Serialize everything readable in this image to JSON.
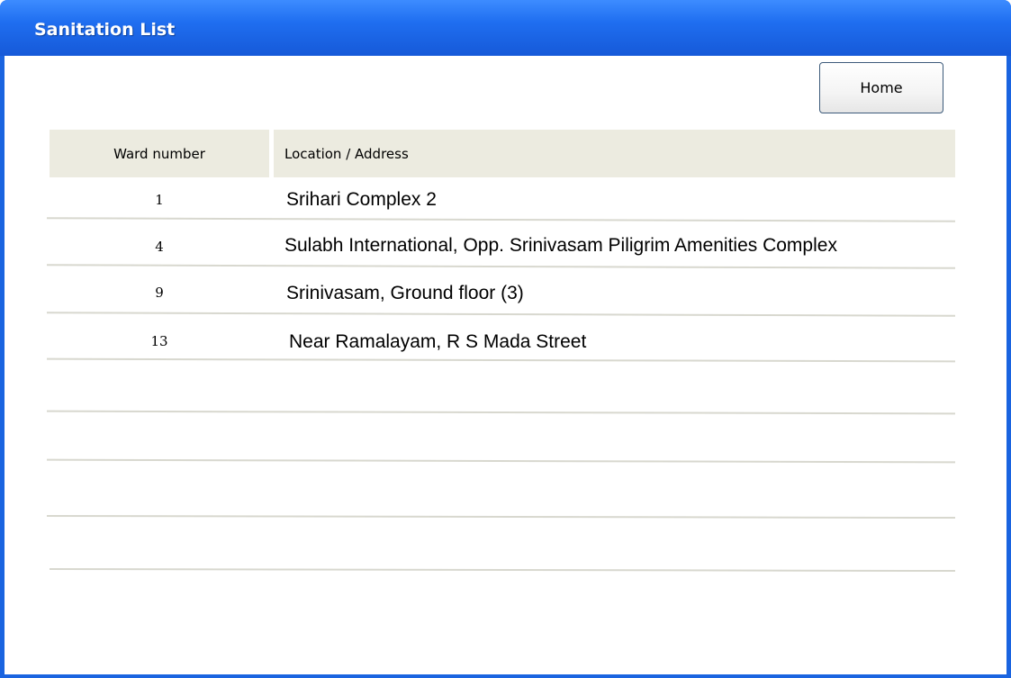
{
  "window": {
    "title": "Sanitation List"
  },
  "toolbar": {
    "home_label": "Home"
  },
  "table": {
    "columns": [
      "Ward number",
      "Location / Address"
    ],
    "rows": [
      {
        "ward": "1",
        "location": "Srihari Complex 2"
      },
      {
        "ward": "4",
        "location": "Sulabh International, Opp. Srinivasam Piligrim Amenities Complex"
      },
      {
        "ward": "9",
        "location": "Srinivasam, Ground floor (3)"
      },
      {
        "ward": "13",
        "location": "Near Ramalayam, R S Mada Street"
      }
    ]
  },
  "colors": {
    "titlebar": "#1f6ef0",
    "header_bg": "#ecebe0",
    "divider": "#d8d8cf"
  }
}
